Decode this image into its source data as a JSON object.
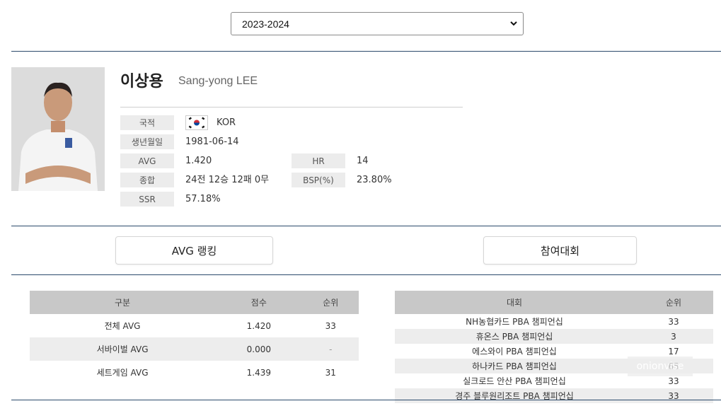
{
  "season_select": {
    "value": "2023-2024"
  },
  "player": {
    "name_ko": "이상용",
    "name_en": "Sang-yong LEE",
    "fields": {
      "nationality_label": "국적",
      "nationality_value": "KOR",
      "birth_label": "생년월일",
      "birth_value": "1981-06-14",
      "avg_label": "AVG",
      "avg_value": "1.420",
      "hr_label": "HR",
      "hr_value": "14",
      "total_label": "종합",
      "total_value": "24전 12승 12패 0무",
      "bsp_label": "BSP(%)",
      "bsp_value": "23.80%",
      "ssr_label": "SSR",
      "ssr_value": "57.18%"
    }
  },
  "tabs": {
    "avg_ranking": "AVG 랭킹",
    "tournaments": "참여대회"
  },
  "avg_table": {
    "headers": [
      "구분",
      "점수",
      "순위"
    ],
    "rows": [
      [
        "전체 AVG",
        "1.420",
        "33"
      ],
      [
        "서바이벌 AVG",
        "0.000",
        "-"
      ],
      [
        "세트게임 AVG",
        "1.439",
        "31"
      ]
    ]
  },
  "tournament_table": {
    "headers": [
      "대회",
      "순위"
    ],
    "rows": [
      [
        "NH농협카드 PBA 챔피언십",
        "33"
      ],
      [
        "휴온스 PBA 챔피언십",
        "3"
      ],
      [
        "에스와이 PBA 챔피언십",
        "17"
      ],
      [
        "하나카드 PBA 챔피언십",
        "65"
      ],
      [
        "실크로드 안산 PBA 챔피언십",
        "33"
      ],
      [
        "경주 블루원리조트 PBA 챔피언십",
        "33"
      ]
    ]
  },
  "watermark": "onionvise",
  "colors": {
    "rule": "#2b4a6b",
    "label_bg": "#ececec",
    "header_bg": "#c8c8c8"
  }
}
